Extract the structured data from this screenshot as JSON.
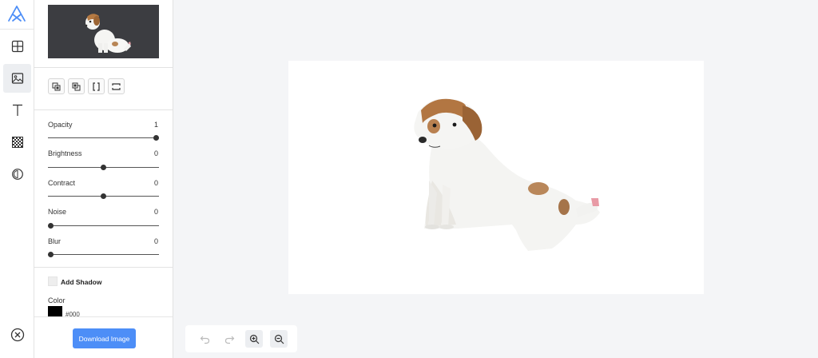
{
  "app": {
    "icons": {
      "logo": "app-logo-icon",
      "templates": "grid-icon",
      "image": "image-icon",
      "text": "text-icon",
      "background": "checkerboard-icon",
      "filter": "contrast-circle-icon",
      "close": "close-circle-icon"
    }
  },
  "panel": {
    "arrange_buttons": [
      {
        "name": "bring-forward-button",
        "icon": "bring-forward-icon"
      },
      {
        "name": "send-backward-button",
        "icon": "send-backward-icon"
      },
      {
        "name": "flip-horizontal-button",
        "icon": "flip-horizontal-icon"
      },
      {
        "name": "flip-vertical-button",
        "icon": "flip-vertical-icon"
      }
    ],
    "sliders": [
      {
        "label": "Opacity",
        "value": "1",
        "level": 1.0
      },
      {
        "label": "Brightness",
        "value": "0",
        "level": 0.5
      },
      {
        "label": "Contract",
        "value": "0",
        "level": 0.5
      },
      {
        "label": "Noise",
        "value": "0",
        "level": 0.0
      },
      {
        "label": "Blur",
        "value": "0",
        "level": 0.0
      }
    ],
    "shadow": {
      "label": "Add Shadow",
      "checked": false,
      "color_label": "Color",
      "color_value": "#000",
      "swatch_color": "#000000"
    },
    "download_label": "Download Image"
  },
  "colors": {
    "accent": "#4d8ef7",
    "thumb_bg": "#3c3d41"
  },
  "bottom_toolbar": {
    "icons": [
      "undo-icon",
      "redo-icon",
      "zoom-in-icon",
      "zoom-out-icon"
    ]
  }
}
